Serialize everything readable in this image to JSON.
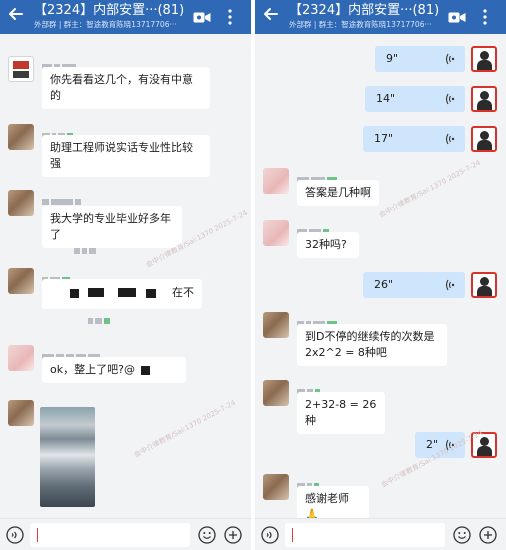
{
  "left": {
    "header": {
      "title": "【2324】内部安置···(81)",
      "subtitle": "外部群  |  群主：智途教育陈晓13717706···"
    },
    "messages": [
      {
        "text": "你先看看这几个，有没有中意的"
      },
      {
        "text": "助理工程师说实话专业性比较强"
      },
      {
        "text": "我大学的专业毕业好多年了"
      },
      {
        "text": "在不"
      },
      {
        "text": "ok，整上了吧?@"
      },
      {
        "text": ""
      }
    ]
  },
  "right": {
    "header": {
      "title": "【2324】内部安置···(81)",
      "subtitle": "外部群  |  群主：智途教育陈晓13717706···"
    },
    "messages": [
      {
        "text": "9\""
      },
      {
        "text": "14\""
      },
      {
        "text": "17\""
      },
      {
        "text": "答案是几种啊"
      },
      {
        "text": "32种吗?"
      },
      {
        "text": "26\""
      },
      {
        "text": "到D不停的继续传的次数是2x2^2 = 8种吧"
      },
      {
        "text": "2+32-8 = 26种"
      },
      {
        "text": "2\""
      },
      {
        "text": "感谢老师🙏"
      }
    ]
  },
  "watermark": "会中介律教育/Sai:1370 2025-7-24",
  "icons": {
    "back": "back-arrow-icon",
    "video": "video-call-icon",
    "more": "more-vertical-icon",
    "voice_message": "voice-message-icon",
    "voice_input": "voice-input-icon",
    "emoji": "emoji-icon",
    "plus": "plus-icon"
  },
  "colors": {
    "header": "#2f68b5",
    "chat_background": "#f2f3f5",
    "incoming_bubble": "#ffffff",
    "outgoing_bubble": "#cfe5fb",
    "caret": "#e43a3a"
  }
}
